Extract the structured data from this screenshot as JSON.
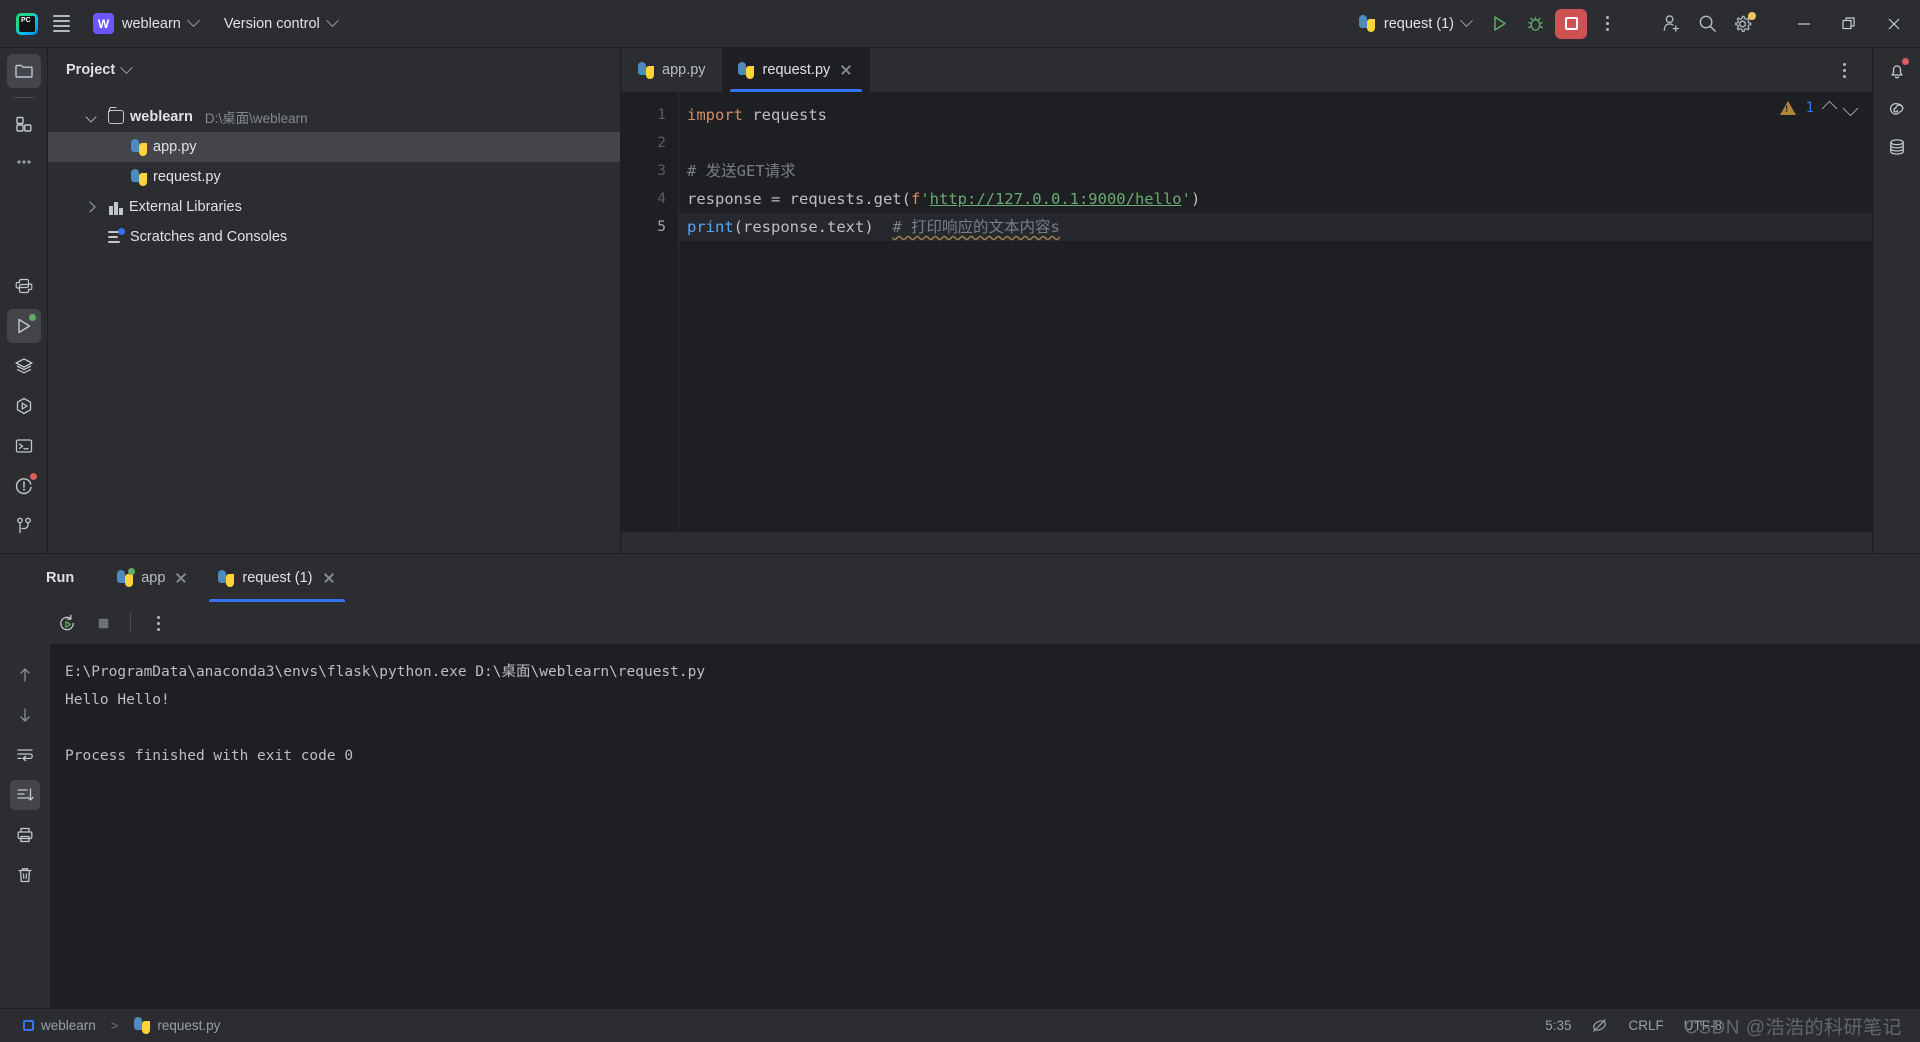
{
  "titlebar": {
    "app_logo": "pycharm-logo",
    "menu_icon": "hamburger-menu-icon",
    "project_initial": "W",
    "project_name": "weblearn",
    "version_control_label": "Version control",
    "run_config_name": "request (1)",
    "run_icon": "run-icon",
    "debug_icon": "debug-icon",
    "stop_icon": "stop-icon",
    "more_icon": "more-vertical-icon",
    "account_icon": "add-user-icon",
    "search_icon": "search-icon",
    "settings_icon": "gear-icon",
    "minimize_icon": "minimize-icon",
    "maximize_icon": "restore-icon",
    "close_icon": "close-icon",
    "accent_blue": "#3574f0",
    "stop_red": "#cf5253",
    "run_green": "#5fad65",
    "settings_badge_color": "#f2c55c"
  },
  "left_stripe": {
    "top": [
      {
        "name": "project-tool-window",
        "icon": "folder-icon",
        "active": true
      },
      {
        "name": "commit-tool-window",
        "icon": "commit-grid-icon",
        "active": false
      },
      {
        "name": "more-tool-windows",
        "icon": "ellipsis-icon",
        "active": false
      }
    ],
    "bottom": [
      {
        "name": "python-packages",
        "icon": "python-icon",
        "active": false,
        "badge": null
      },
      {
        "name": "run-tool-window",
        "icon": "run-triangle-icon",
        "active": true,
        "badge": "#5fad65"
      },
      {
        "name": "services-tool-window",
        "icon": "layers-icon",
        "active": false,
        "badge": null
      },
      {
        "name": "python-console",
        "icon": "hexagon-play-icon",
        "active": false,
        "badge": null
      },
      {
        "name": "terminal-tool-window",
        "icon": "terminal-icon",
        "active": false,
        "badge": null
      },
      {
        "name": "problems-tool-window",
        "icon": "warning-circle-icon",
        "active": false,
        "badge": "#db5c5c"
      },
      {
        "name": "version-control-tool-window",
        "icon": "branch-icon",
        "active": false,
        "badge": null
      }
    ]
  },
  "project_panel": {
    "title": "Project",
    "title_chevron": "chevron-down-icon",
    "tree": [
      {
        "label": "weblearn",
        "path": "D:\\桌面\\weblearn",
        "icon": "folder-icon",
        "arrow": "open",
        "depth": 0,
        "bold": true,
        "selected": false
      },
      {
        "label": "app.py",
        "path": "",
        "icon": "python-file-icon",
        "arrow": "none",
        "depth": 1,
        "bold": false,
        "selected": true
      },
      {
        "label": "request.py",
        "path": "",
        "icon": "python-file-icon",
        "arrow": "none",
        "depth": 1,
        "bold": false,
        "selected": false
      },
      {
        "label": "External Libraries",
        "path": "",
        "icon": "library-icon",
        "arrow": "closed",
        "depth": 0,
        "bold": false,
        "selected": false
      },
      {
        "label": "Scratches and Consoles",
        "path": "",
        "icon": "scratches-icon",
        "arrow": "none",
        "depth": 0,
        "bold": false,
        "selected": false
      }
    ]
  },
  "editor": {
    "tabs": [
      {
        "label": "app.py",
        "icon": "python-file-icon",
        "active": false,
        "closable": false
      },
      {
        "label": "request.py",
        "icon": "python-file-icon",
        "active": true,
        "closable": true
      }
    ],
    "tab_options_icon": "more-vertical-icon",
    "inspection": {
      "warning_icon": "warning-triangle-icon",
      "count": "1",
      "prev_icon": "chevron-up-icon",
      "next_icon": "chevron-down-icon"
    },
    "line_numbers": [
      "1",
      "2",
      "3",
      "4",
      "5"
    ],
    "current_line": 5,
    "lines": [
      [
        {
          "t": "import",
          "c": "kw"
        },
        {
          "t": " requests",
          "c": "plain"
        }
      ],
      [],
      [
        {
          "t": "# 发送GET请求",
          "c": "com"
        }
      ],
      [
        {
          "t": "response = requests.get(",
          "c": "plain"
        },
        {
          "t": "f",
          "c": "prefix"
        },
        {
          "t": "'",
          "c": "str"
        },
        {
          "t": "http://127.0.0.1:9000/hello",
          "c": "str-u"
        },
        {
          "t": "'",
          "c": "str"
        },
        {
          "t": ")",
          "c": "plain"
        }
      ],
      [
        {
          "t": "print",
          "c": "fn"
        },
        {
          "t": "(response.text)  ",
          "c": "plain"
        },
        {
          "t": "# 打印响应的文本内容s",
          "c": "com-warn"
        }
      ]
    ]
  },
  "run_panel": {
    "title": "Run",
    "tabs": [
      {
        "label": "app",
        "icon": "python-icon-running",
        "active": false,
        "closable": true
      },
      {
        "label": "request (1)",
        "icon": "python-icon",
        "active": true,
        "closable": true
      }
    ],
    "toolbar": [
      {
        "name": "rerun-button",
        "icon": "rerun-icon"
      },
      {
        "name": "stop-button",
        "icon": "stop-square-icon"
      },
      {
        "name": "more-options-button",
        "icon": "more-vertical-icon"
      }
    ],
    "console_gutter": [
      {
        "name": "up-button",
        "icon": "arrow-up-icon",
        "active": false
      },
      {
        "name": "down-button",
        "icon": "arrow-down-icon",
        "active": false
      },
      {
        "name": "soft-wrap-button",
        "icon": "soft-wrap-icon",
        "active": false
      },
      {
        "name": "scroll-to-end-button",
        "icon": "scroll-to-end-icon",
        "active": true
      },
      {
        "name": "print-button",
        "icon": "printer-icon",
        "active": false
      },
      {
        "name": "clear-all-button",
        "icon": "trash-icon",
        "active": false
      }
    ],
    "console_output": [
      "E:\\ProgramData\\anaconda3\\envs\\flask\\python.exe D:\\桌面\\weblearn\\request.py",
      "Hello Hello!",
      "",
      "Process finished with exit code 0"
    ]
  },
  "right_stripe": [
    {
      "name": "notifications-tool-window",
      "icon": "bell-icon",
      "badge": "#db5c5c"
    },
    {
      "name": "ai-assistant-tool-window",
      "icon": "spiral-icon",
      "badge": null
    },
    {
      "name": "database-tool-window",
      "icon": "database-icon",
      "badge": null
    }
  ],
  "statusbar": {
    "breadcrumb_project": "weblearn",
    "breadcrumb_separator": ">",
    "breadcrumb_file": "request.py",
    "breadcrumb_file_icon": "python-file-icon",
    "caret_position": "5:35",
    "inspection_icon": "inspection-off-icon",
    "line_separator": "CRLF",
    "encoding": "UTF-8",
    "watermark": "CSDN @浩浩的科研笔记"
  }
}
